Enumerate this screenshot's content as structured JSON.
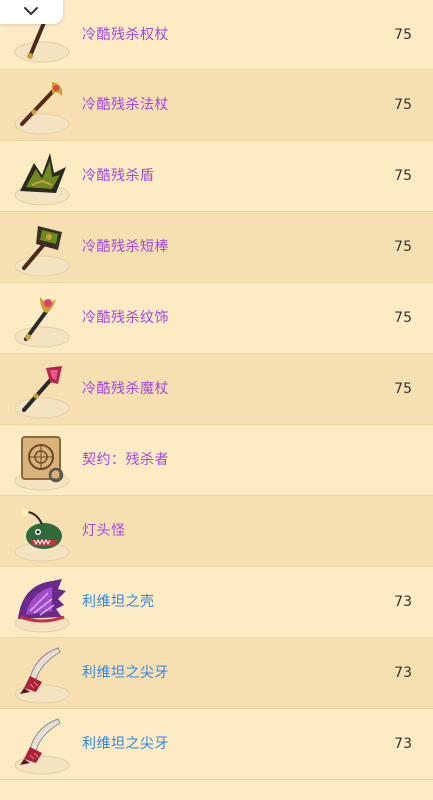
{
  "collapse_icon": "chevron-down-icon",
  "colors": {
    "row_light": "#fdebc4",
    "row_dark": "#f6e0b2",
    "name_purple": "#a048e0",
    "name_blue": "#2f86e8",
    "level_text": "#333333"
  },
  "items": [
    {
      "name": "冷酷残杀权杖",
      "level": "75",
      "color": "purple",
      "icon": "scepter-icon"
    },
    {
      "name": "冷酷残杀法杖",
      "level": "75",
      "color": "purple",
      "icon": "staff-icon"
    },
    {
      "name": "冷酷残杀盾",
      "level": "75",
      "color": "purple",
      "icon": "shield-icon"
    },
    {
      "name": "冷酷残杀短棒",
      "level": "75",
      "color": "purple",
      "icon": "short-club-icon"
    },
    {
      "name": "冷酷残杀纹饰",
      "level": "75",
      "color": "purple",
      "icon": "emblem-icon"
    },
    {
      "name": "冷酷残杀魔杖",
      "level": "75",
      "color": "purple",
      "icon": "wand-icon"
    },
    {
      "name": "契约：残杀者",
      "level": "",
      "color": "purple",
      "icon": "contract-scroll-icon"
    },
    {
      "name": "灯头怪",
      "level": "",
      "color": "purple",
      "icon": "anglerfish-pet-icon"
    },
    {
      "name": "利维坦之壳",
      "level": "73",
      "color": "blue",
      "icon": "shell-icon"
    },
    {
      "name": "利维坦之尖牙",
      "level": "73",
      "color": "blue",
      "icon": "fang-icon"
    },
    {
      "name": "利维坦之尖牙",
      "level": "73",
      "color": "blue",
      "icon": "fang-icon"
    }
  ]
}
